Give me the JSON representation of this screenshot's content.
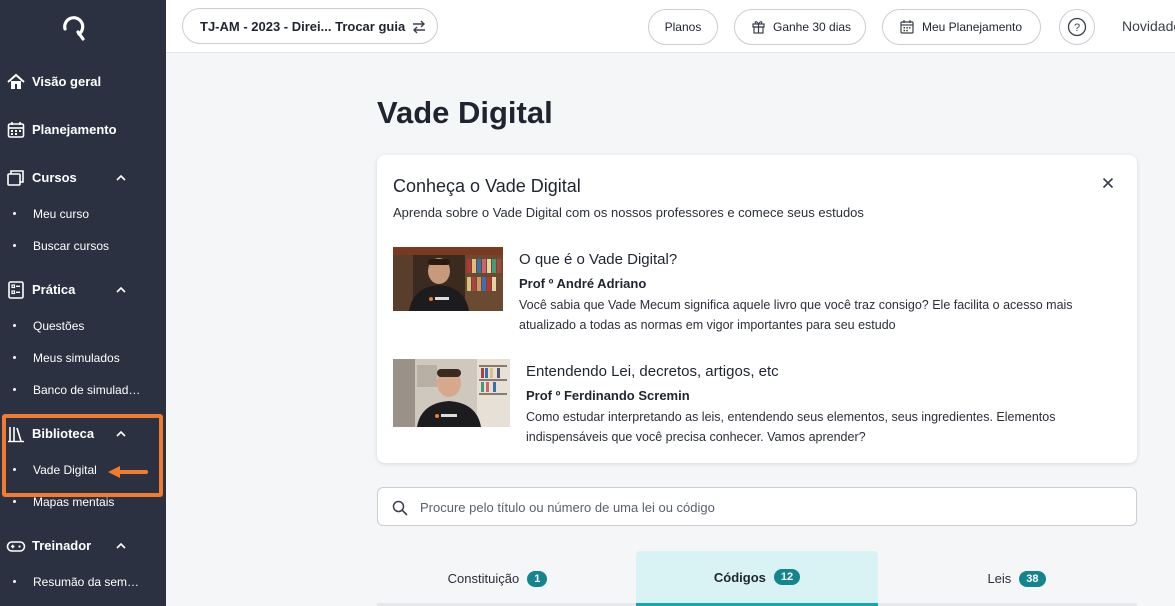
{
  "sidebar": {
    "sections": [
      {
        "label": "Visão geral",
        "icon": "home-icon"
      },
      {
        "label": "Planejamento",
        "icon": "calendar-icon"
      },
      {
        "label": "Cursos",
        "icon": "courses-icon"
      },
      {
        "label": "Prática",
        "icon": "practice-icon"
      },
      {
        "label": "Biblioteca",
        "icon": "library-icon"
      },
      {
        "label": "Treinador",
        "icon": "gamepad-icon"
      }
    ],
    "subitems": [
      "Meu curso",
      "Buscar cursos",
      "Questões",
      "Meus simulados",
      "Banco de simulados",
      "Vade Digital",
      "Mapas mentais",
      "Resumão da semana"
    ]
  },
  "topbar": {
    "guide": "TJ-AM - 2023 - Direi... Trocar guia",
    "planos": "Planos",
    "ganhe": "Ganhe 30 dias",
    "meu_planejamento": "Meu Planejamento",
    "help": "?",
    "novidades": "Novidades"
  },
  "main": {
    "title": "Vade Digital",
    "card": {
      "title": "Conheça o Vade Digital",
      "subtitle": "Aprenda sobre o Vade Digital com os nossos professores e comece seus estudos",
      "videos": [
        {
          "title": "O que é o Vade Digital?",
          "prof": "Prof º André Adriano",
          "desc": "Você sabia que Vade Mecum significa aquele livro que você traz consigo? Ele facilita o acesso mais atualizado a todas as normas em vigor importantes para seu estudo"
        },
        {
          "title": "Entendendo Lei, decretos, artigos, etc",
          "prof": "Prof º Ferdinando Scremin",
          "desc": "Como estudar interpretando as leis, entendendo seus elementos, seus ingredientes. Elementos indispensáveis que você precisa conhecer. Vamos aprender?"
        }
      ]
    },
    "search": {
      "placeholder": "Procure pelo título ou número de uma lei ou código"
    },
    "tabs": [
      {
        "label": "Constituição",
        "count": "1"
      },
      {
        "label": "Códigos",
        "count": "12"
      },
      {
        "label": "Leis",
        "count": "38"
      }
    ]
  },
  "colors": {
    "sidebar_bg": "#2b3140",
    "highlight": "#f07c31",
    "accent": "#12858f"
  }
}
